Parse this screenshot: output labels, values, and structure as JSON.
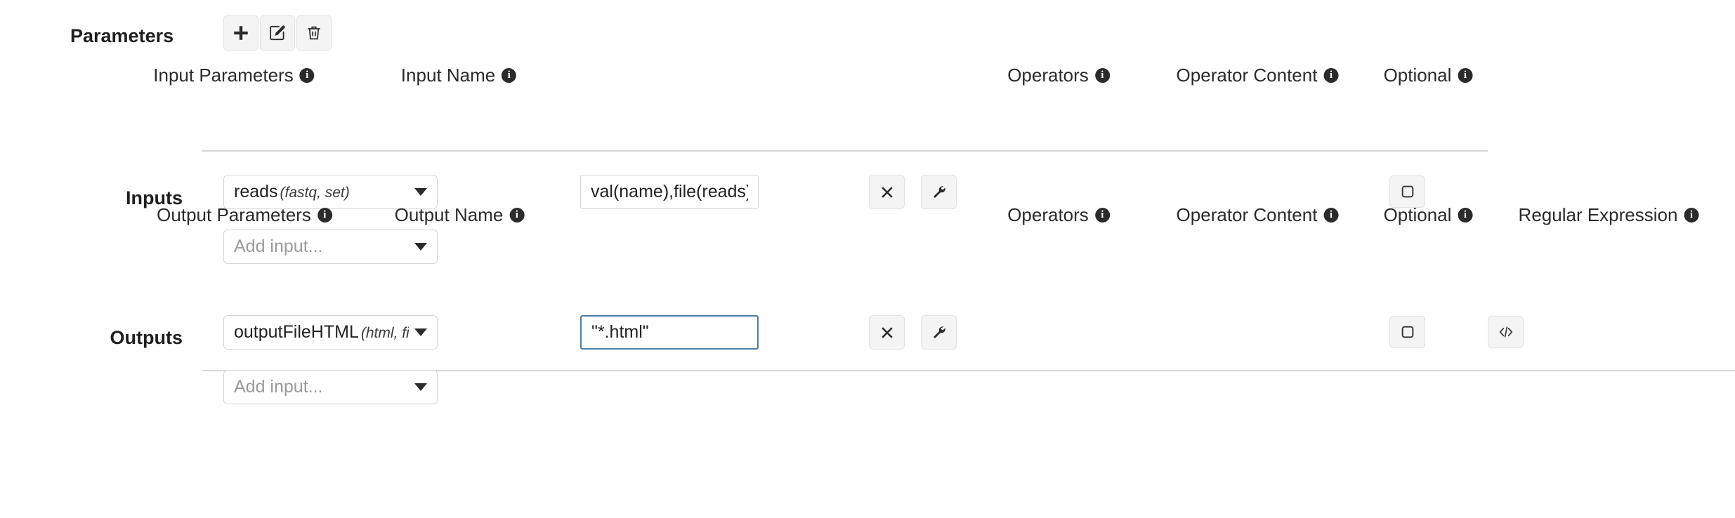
{
  "section": {
    "title": "Parameters",
    "toolbar": [
      {
        "name": "add-parameter-button",
        "icon": "plus-icon"
      },
      {
        "name": "edit-parameter-button",
        "icon": "pencil-square-icon"
      },
      {
        "name": "delete-parameter-button",
        "icon": "trash-icon"
      }
    ]
  },
  "inputs": {
    "row_label": "Inputs",
    "headers": [
      {
        "label": "Input Parameters",
        "info": "i"
      },
      {
        "label": "Input Name",
        "info": "i"
      },
      {
        "label": "Operators",
        "info": "i"
      },
      {
        "label": "Operator Content",
        "info": "i"
      },
      {
        "label": "Optional",
        "info": "i"
      }
    ],
    "rows": [
      {
        "parameter_name": "reads",
        "parameter_type": "(fastq, set)",
        "name_value": "val(name),file(reads)",
        "clear_icon": "cross-icon",
        "settings_icon": "wrench-icon",
        "operators": "",
        "operator_content": "",
        "optional_checked": false,
        "optional_icon": "checkbox-unchecked-icon"
      }
    ],
    "add_row_placeholder": "Add input...",
    "add_row_caret": "chevron-down-icon"
  },
  "outputs": {
    "row_label": "Outputs",
    "headers": [
      {
        "label": "Output Parameters",
        "info": "i"
      },
      {
        "label": "Output Name",
        "info": "i"
      },
      {
        "label": "Operators",
        "info": "i"
      },
      {
        "label": "Operator Content",
        "info": "i"
      },
      {
        "label": "Optional",
        "info": "i"
      },
      {
        "label": "Regular Expression",
        "info": "i"
      }
    ],
    "rows": [
      {
        "parameter_name": "outputFileHTML",
        "parameter_type": "(html, file)",
        "name_value": "\"*.html\"",
        "name_focused": true,
        "clear_icon": "cross-icon",
        "settings_icon": "wrench-icon",
        "operators": "",
        "operator_content": "",
        "optional_checked": false,
        "optional_icon": "checkbox-unchecked-icon",
        "regex_icon": "code-brackets-icon"
      }
    ],
    "add_row_placeholder": "Add input...",
    "add_row_caret": "chevron-down-icon"
  },
  "colors": {
    "focus_border": "#4a80a8",
    "button_bg": "#f4f4f4",
    "button_border": "#e2e2e2",
    "divider": "#d8d8d8",
    "text": "#2f2f2f",
    "placeholder": "#9a9a9a"
  }
}
